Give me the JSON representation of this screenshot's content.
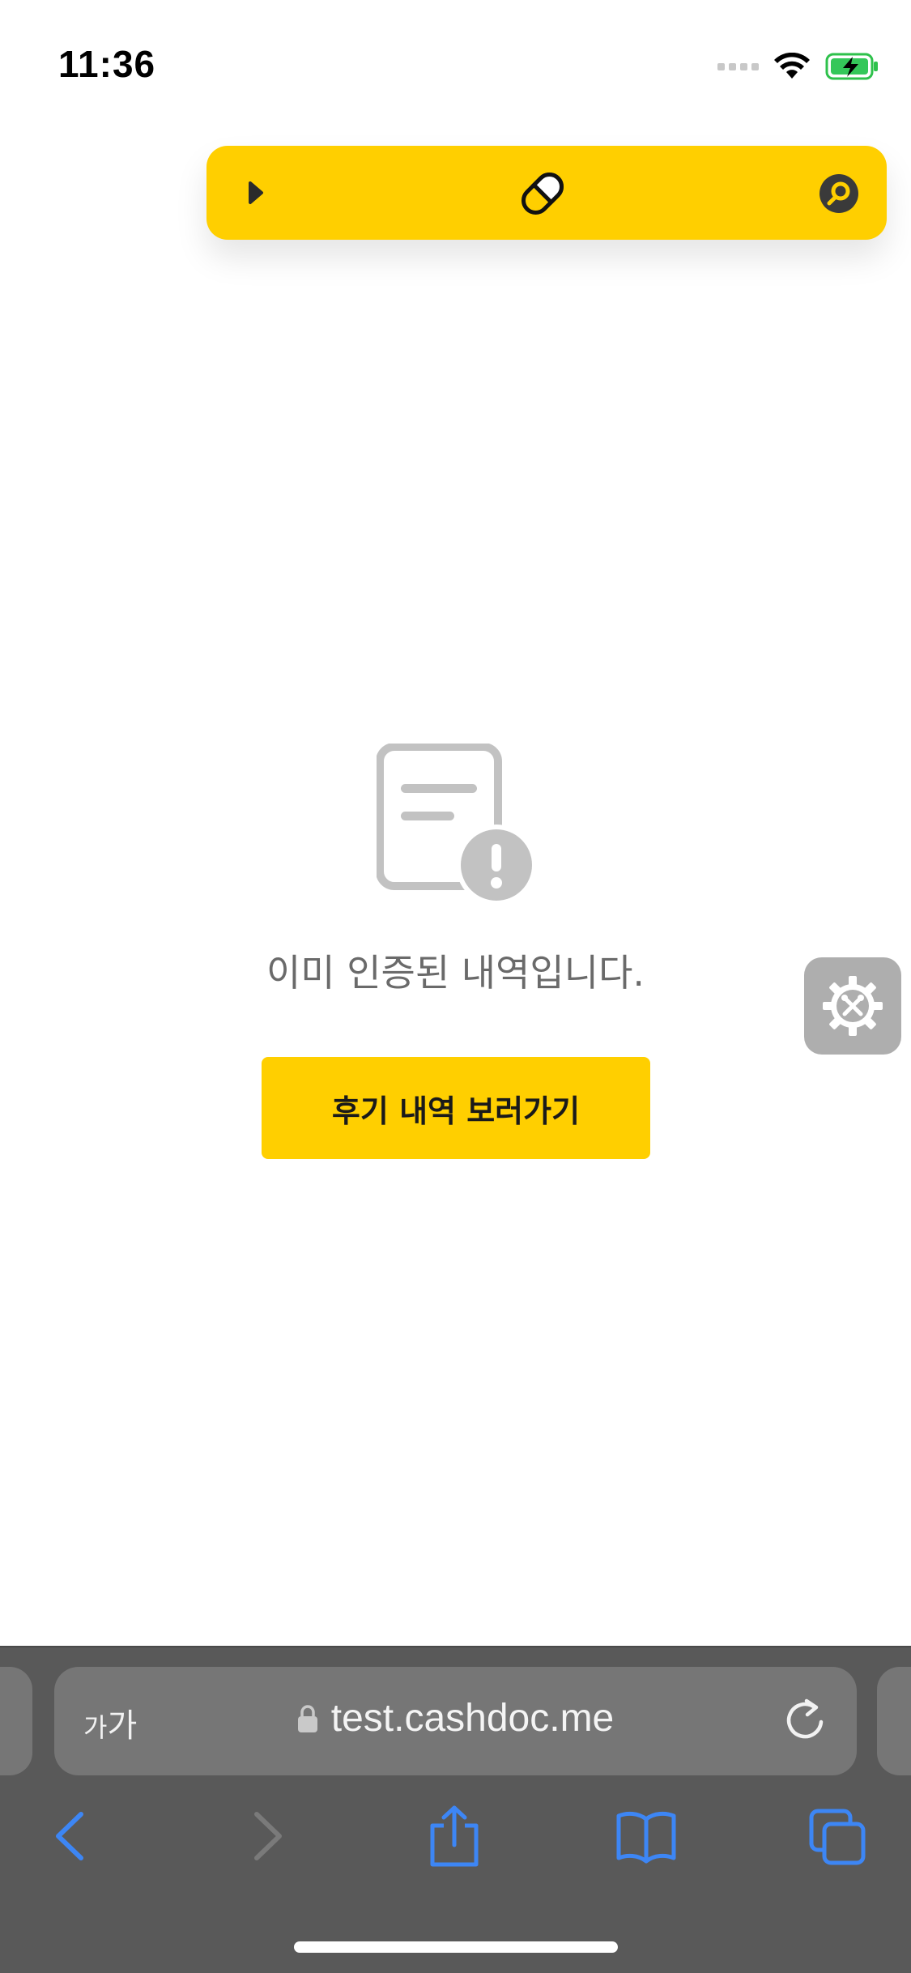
{
  "status_bar": {
    "time": "11:36"
  },
  "colors": {
    "accent": "#ffcf00",
    "browser_chrome": "#595959",
    "address_bar": "#767676",
    "toolbar_icon_blue": "#3d86f5",
    "disabled_icon": "#7a7a7a",
    "empty_icon_gray": "#c2c2c2"
  },
  "floating_toolbar": {
    "left_icon": "play-triangle-icon",
    "center_icon": "pill-capsule-icon",
    "right_icon": "search-icon"
  },
  "empty_state": {
    "icon": "document-alert-icon",
    "message": "이미 인증된 내역입니다.",
    "button_label": "후기 내역 보러가기"
  },
  "settings_widget": {
    "icon": "gear-tools-icon"
  },
  "browser": {
    "text_size_small": "가",
    "text_size_large": "가",
    "lock_icon": "lock-icon",
    "url": "test.cashdoc.me",
    "reload_icon": "reload-icon",
    "toolbar_icons": [
      "back-icon",
      "forward-icon",
      "share-icon",
      "bookmarks-icon",
      "tabs-icon"
    ]
  }
}
